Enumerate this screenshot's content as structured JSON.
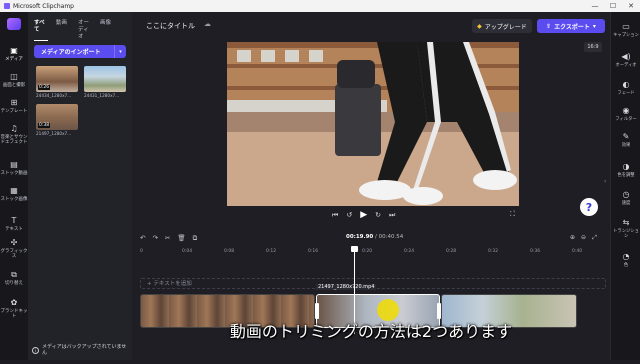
{
  "window": {
    "title": "Microsoft Clipchamp",
    "minimize": "—",
    "maximize": "☐",
    "close": "✕"
  },
  "left_rail": [
    {
      "label": "メディア",
      "icon": "▣"
    },
    {
      "label": "画面と撮影",
      "icon": "◫"
    },
    {
      "label": "テンプレート",
      "icon": "⊞"
    },
    {
      "label": "音楽とサウンドエフェクト",
      "icon": "♫"
    },
    {
      "label": "ストック動画",
      "icon": "▤"
    },
    {
      "label": "ストック画像",
      "icon": "▦"
    },
    {
      "label": "テキスト",
      "icon": "T"
    },
    {
      "label": "グラフィックス",
      "icon": "✣"
    },
    {
      "label": "切り替え",
      "icon": "⧉"
    },
    {
      "label": "ブランドキット",
      "icon": "✿"
    }
  ],
  "media_panel": {
    "tabs": [
      "すべて",
      "動画",
      "オーディオ",
      "画像"
    ],
    "import_label": "メディアのインポート",
    "items": [
      {
        "name": "24434_1280x7...",
        "duration": "0:26"
      },
      {
        "name": "24431_1280x7...",
        "duration": ""
      },
      {
        "name": "21497_1280x7...",
        "duration": "0:38"
      }
    ],
    "backup_text": "メディアはバックアップされていません"
  },
  "header": {
    "project_title": "ここにタイトル",
    "upgrade_label": "アップグレード",
    "export_label": "エクスポート"
  },
  "preview": {
    "aspect_ratio": "16:9"
  },
  "timeline": {
    "current_time": "00:19.90",
    "total_time": "00:40.54",
    "ruler_ticks": [
      "0",
      "0:04",
      "0:08",
      "0:12",
      "0:16",
      "0:20",
      "0:24",
      "0:28",
      "0:32",
      "0:36",
      "0:40"
    ],
    "text_track_label": "+ テキストを追加",
    "selected_clip_name": "21497_1280x720.mp4"
  },
  "subtitle": "動画のトリミングの方法は2つあります",
  "right_rail": [
    {
      "label": "キャプション",
      "icon": "▭"
    },
    {
      "label": "オーディオ",
      "icon": "◀)"
    },
    {
      "label": "フェード",
      "icon": "◐"
    },
    {
      "label": "フィルター",
      "icon": "◉"
    },
    {
      "label": "効果",
      "icon": "✎"
    },
    {
      "label": "色を調整",
      "icon": "◑"
    },
    {
      "label": "速度",
      "icon": "◷"
    },
    {
      "label": "トランジション",
      "icon": "⇆"
    },
    {
      "label": "色",
      "icon": "◔"
    }
  ],
  "colors": {
    "accent": "#5b4cf0",
    "background": "#1e1e24",
    "panel": "#222229"
  }
}
